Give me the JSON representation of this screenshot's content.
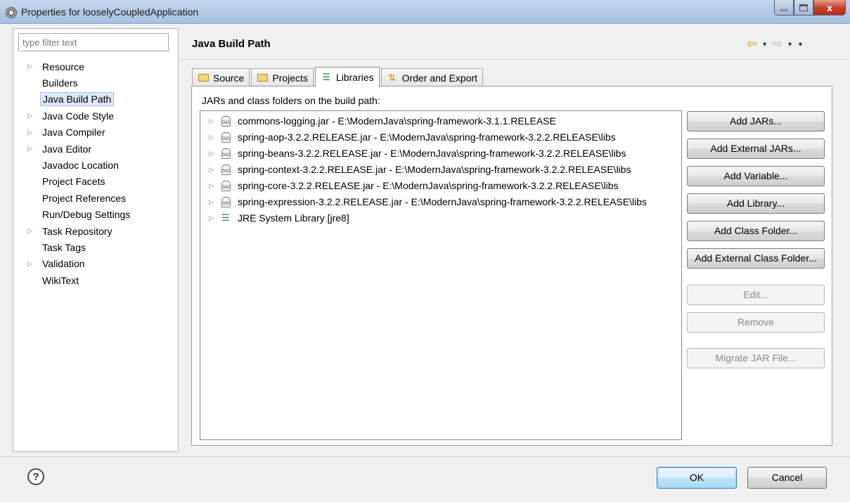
{
  "window": {
    "title": "Properties for looselyCoupledApplication",
    "close_glyph": "x"
  },
  "left": {
    "filter_placeholder": "type filter text",
    "items": [
      {
        "label": "Resource",
        "expandable": true
      },
      {
        "label": "Builders",
        "expandable": false
      },
      {
        "label": "Java Build Path",
        "expandable": false,
        "selected": true
      },
      {
        "label": "Java Code Style",
        "expandable": true
      },
      {
        "label": "Java Compiler",
        "expandable": true
      },
      {
        "label": "Java Editor",
        "expandable": true
      },
      {
        "label": "Javadoc Location",
        "expandable": false
      },
      {
        "label": "Project Facets",
        "expandable": false
      },
      {
        "label": "Project References",
        "expandable": false
      },
      {
        "label": "Run/Debug Settings",
        "expandable": false
      },
      {
        "label": "Task Repository",
        "expandable": true
      },
      {
        "label": "Task Tags",
        "expandable": false
      },
      {
        "label": "Validation",
        "expandable": true
      },
      {
        "label": "WikiText",
        "expandable": false
      }
    ]
  },
  "page": {
    "title": "Java Build Path"
  },
  "tabs": {
    "source": "Source",
    "projects": "Projects",
    "libraries": "Libraries",
    "order": "Order and Export",
    "active": "Libraries"
  },
  "libraries": {
    "label": "JARs and class folders on the build path:",
    "jar_icon_text": "010",
    "items": [
      "commons-logging.jar - E:\\ModernJava\\spring-framework-3.1.1.RELEASE",
      "spring-aop-3.2.2.RELEASE.jar - E:\\ModernJava\\spring-framework-3.2.2.RELEASE\\libs",
      "spring-beans-3.2.2.RELEASE.jar - E:\\ModernJava\\spring-framework-3.2.2.RELEASE\\libs",
      "spring-context-3.2.2.RELEASE.jar - E:\\ModernJava\\spring-framework-3.2.2.RELEASE\\libs",
      "spring-core-3.2.2.RELEASE.jar - E:\\ModernJava\\spring-framework-3.2.2.RELEASE\\libs",
      "spring-expression-3.2.2.RELEASE.jar - E:\\ModernJava\\spring-framework-3.2.2.RELEASE\\libs",
      "JRE System Library [jre8]"
    ]
  },
  "buttons": {
    "add_jars": "Add JARs...",
    "add_external_jars": "Add External JARs...",
    "add_variable": "Add Variable...",
    "add_library": "Add Library...",
    "add_class_folder": "Add Class Folder...",
    "add_external_class_folder": "Add External Class Folder...",
    "edit": "Edit...",
    "remove": "Remove",
    "migrate_jar": "Migrate JAR File..."
  },
  "footer": {
    "help_glyph": "?",
    "ok": "OK",
    "cancel": "Cancel"
  },
  "colors": {
    "titlebar": "#b6cbe6",
    "selected_item": "#dfe8f6",
    "ok_button": "#bfe3f8",
    "close_button": "#c9442c"
  }
}
